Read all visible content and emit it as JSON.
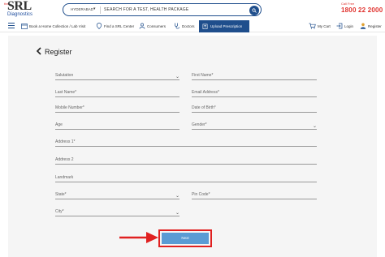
{
  "brand": {
    "tag": "the",
    "name": "SRL",
    "sub": "Diagnostics"
  },
  "search": {
    "city": "HYDERABAD",
    "placeholder": "SEARCH FOR A TEST, HEALTH PACKAGE"
  },
  "contact": {
    "label": "Call Free",
    "phone": "1800 22 2000"
  },
  "nav": {
    "items": [
      "Book a Home Collection / Lab Visit",
      "Find a SRL Center",
      "Consumers",
      "Doctors",
      "Upload Prescription"
    ],
    "right": [
      "My Cart",
      "Login",
      "Register"
    ]
  },
  "form": {
    "title": "Register",
    "fields": {
      "salutation": "Salutation",
      "first_name": "First Name*",
      "last_name": "Last Name*",
      "email": "Email Address*",
      "mobile": "Mobile Number*",
      "dob": "Date of Birth*",
      "age": "Age",
      "gender": "Gender*",
      "address1": "Address 1*",
      "address2": "Address 2",
      "landmark": "Landmark",
      "state": "State*",
      "pin": "Pin Code*",
      "city": "City*"
    },
    "submit_label": "Next"
  },
  "colors": {
    "brand_blue": "#1f4e8c",
    "accent_red": "#e0322e",
    "button": "#5a9bd4"
  }
}
